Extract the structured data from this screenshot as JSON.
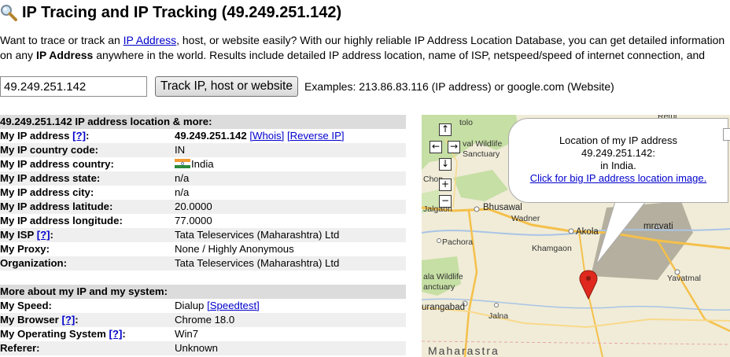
{
  "page": {
    "title": "IP Tracing and IP Tracking (49.249.251.142)",
    "intro_line1_a": "Want to trace or track an ",
    "intro_line1_link": "IP Address",
    "intro_line1_b": ", host, or website easily? With our highly reliable IP Address Location Database, you can get detailed information",
    "intro_line2_a": "on any ",
    "intro_line2_bold": "IP Address",
    "intro_line2_b": " anywhere in the world. Results include detailed IP address location, name of ISP, netspeed/speed of internet connection, and"
  },
  "search": {
    "value": "49.249.251.142",
    "button_label": "Track IP, host or website",
    "examples": "Examples: 213.86.83.116 (IP address) or google.com (Website)"
  },
  "location_section": {
    "header": "49.249.251.142 IP address location & more:",
    "ip_label": "My IP address",
    "help_label": "[?]",
    "ip_value": "49.249.251.142",
    "whois_label": "[Whois]",
    "reverse_label": "[Reverse IP]",
    "country_code_label": "My IP country code:",
    "country_code": "IN",
    "country_label": "My IP address country:",
    "country": "India",
    "state_label": "My IP address state:",
    "state": "n/a",
    "city_label": "My IP address city:",
    "city": "n/a",
    "latitude_label": "My IP address latitude:",
    "latitude": "20.0000",
    "longitude_label": "My IP address longitude:",
    "longitude": "77.0000",
    "isp_label": "My ISP",
    "isp": "Tata Teleservices (Maharashtra) Ltd",
    "proxy_label": "My Proxy:",
    "proxy": "None / Highly Anonymous",
    "org_label": "Organization:",
    "organization": "Tata Teleservices (Maharashtra) Ltd"
  },
  "system_section": {
    "header": "More about my IP and my system:",
    "speed_label": "My Speed:",
    "speed": "Dialup",
    "speedtest_label": "[Speedtest]",
    "browser_label": "My Browser",
    "browser": "Chrome 18.0",
    "os_label": "My Operating System",
    "os": "Win7",
    "referer_label": "Referer:",
    "referer": "Unknown"
  },
  "map": {
    "bubble_line1": "Location of my IP address",
    "bubble_line2": "49.249.251.142:",
    "bubble_line3": "in India.",
    "bubble_link": "Click for big IP address location image.",
    "controls": {
      "up": "↑",
      "left": "←",
      "right": "→",
      "down": "↓",
      "zoom_in": "+",
      "zoom_out": "−"
    },
    "labels": {
      "tolo": "tolo",
      "retul": "Retul",
      "wildlife_a": "val Wildlife",
      "sanctuary": "Sanctuary",
      "chopda": "Chop",
      "bhusawal": "Bhusawal",
      "wadner": "Wadner",
      "akola": "Akola",
      "amravati": "mravati",
      "khamgaon": "Khamgaon",
      "pachora": "Pachora",
      "jalgaon": "Jalgaon",
      "wildlife_b": "ala Wildlife",
      "sanctuary_b": "anctuary",
      "yavatmal": "Yavatmal",
      "aurangabad": "urangabad",
      "jalna": "Jalna",
      "maharashtra": "Maharastra"
    },
    "colors": {
      "land": "#f0ecd8",
      "forest": "#c6dfa4",
      "road": "#f5c04a",
      "marker": "#e0291e"
    }
  }
}
